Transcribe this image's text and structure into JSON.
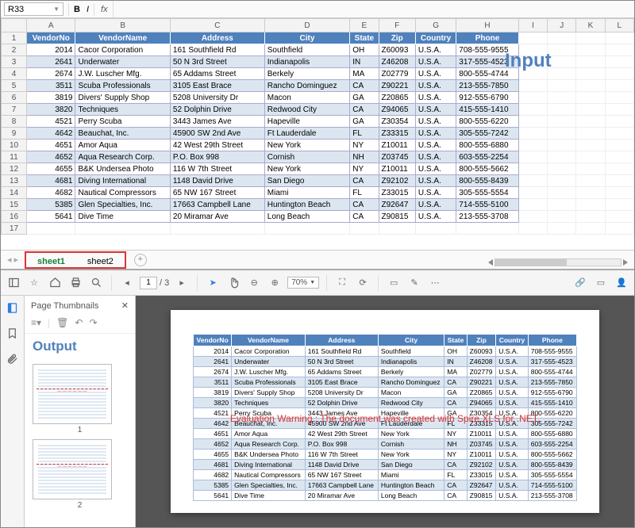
{
  "formula_bar": {
    "cell_ref": "R33",
    "fx": "fx"
  },
  "col_headers": [
    "A",
    "B",
    "C",
    "D",
    "E",
    "F",
    "G",
    "H",
    "I",
    "J",
    "K",
    "L"
  ],
  "row_headers": [
    1,
    2,
    3,
    4,
    5,
    6,
    7,
    8,
    9,
    10,
    11,
    12,
    13,
    14,
    15,
    16,
    17
  ],
  "table_headers": [
    "VendorNo",
    "VendorName",
    "Address",
    "City",
    "State",
    "Zip",
    "Country",
    "Phone"
  ],
  "rows": [
    [
      "2014",
      "Cacor Corporation",
      "161 Southfield Rd",
      "Southfield",
      "OH",
      "Z60093",
      "U.S.A.",
      "708-555-9555"
    ],
    [
      "2641",
      "Underwater",
      "50 N 3rd Street",
      "Indianapolis",
      "IN",
      "Z46208",
      "U.S.A.",
      "317-555-4523"
    ],
    [
      "2674",
      "J.W.  Luscher Mfg.",
      "65 Addams Street",
      "Berkely",
      "MA",
      "Z02779",
      "U.S.A.",
      "800-555-4744"
    ],
    [
      "3511",
      "Scuba Professionals",
      "3105 East Brace",
      "Rancho Dominguez",
      "CA",
      "Z90221",
      "U.S.A.",
      "213-555-7850"
    ],
    [
      "3819",
      "Divers'  Supply Shop",
      "5208 University Dr",
      "Macon",
      "GA",
      "Z20865",
      "U.S.A.",
      "912-555-6790"
    ],
    [
      "3820",
      "Techniques",
      "52 Dolphin Drive",
      "Redwood City",
      "CA",
      "Z94065",
      "U.S.A.",
      "415-555-1410"
    ],
    [
      "4521",
      "Perry Scuba",
      "3443 James Ave",
      "Hapeville",
      "GA",
      "Z30354",
      "U.S.A.",
      "800-555-6220"
    ],
    [
      "4642",
      "Beauchat, Inc.",
      "45900 SW 2nd Ave",
      "Ft Lauderdale",
      "FL",
      "Z33315",
      "U.S.A.",
      "305-555-7242"
    ],
    [
      "4651",
      "Amor Aqua",
      "42 West 29th Street",
      "New York",
      "NY",
      "Z10011",
      "U.S.A.",
      "800-555-6880"
    ],
    [
      "4652",
      "Aqua Research Corp.",
      "P.O. Box 998",
      "Cornish",
      "NH",
      "Z03745",
      "U.S.A.",
      "603-555-2254"
    ],
    [
      "4655",
      "B&K Undersea Photo",
      "116 W 7th Street",
      "New York",
      "NY",
      "Z10011",
      "U.S.A.",
      "800-555-5662"
    ],
    [
      "4681",
      "Diving International",
      "1148 David Drive",
      "San Diego",
      "CA",
      "Z92102",
      "U.S.A.",
      "800-555-8439"
    ],
    [
      "4682",
      "Nautical Compressors",
      "65 NW 167 Street",
      "Miami",
      "FL",
      "Z33015",
      "U.S.A.",
      "305-555-5554"
    ],
    [
      "5385",
      "Glen Specialties, Inc.",
      "17663 Campbell Lane",
      "Huntington Beach",
      "CA",
      "Z92647",
      "U.S.A.",
      "714-555-5100"
    ],
    [
      "5641",
      "Dive Time",
      "20 Miramar Ave",
      "Long Beach",
      "CA",
      "Z90815",
      "U.S.A.",
      "213-555-3708"
    ]
  ],
  "input_label": "Input",
  "sheets": {
    "tabs": [
      "sheet1",
      "sheet2"
    ],
    "active": 0,
    "add": "+"
  },
  "pdf_toolbar": {
    "page_current": "1",
    "page_sep": "/",
    "page_total": "3",
    "zoom": "70%"
  },
  "thumbnails": {
    "title": "Page Thumbnails",
    "output_label": "Output",
    "pages": [
      "1",
      "2"
    ]
  },
  "eval_warning": "Evaluation Warning : The document was created with Spire.XLS for .NET."
}
